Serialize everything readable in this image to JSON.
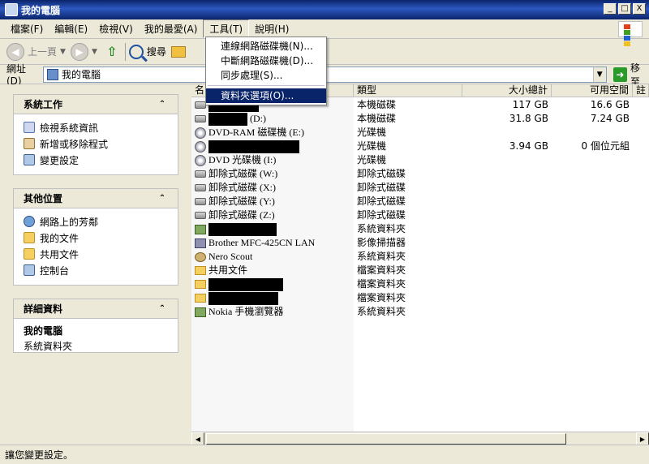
{
  "window": {
    "title": "我的電腦",
    "controls": {
      "minimize": "_",
      "maximize": "□",
      "close": "X"
    }
  },
  "menubar": {
    "items": [
      "檔案(F)",
      "編輯(E)",
      "檢視(V)",
      "我的最愛(A)",
      "工具(T)",
      "說明(H)"
    ],
    "active_index": 4
  },
  "toolbar": {
    "back_label": "上一頁",
    "search_label": "搜尋"
  },
  "address": {
    "label": "網址(D)",
    "value": "我的電腦",
    "go_label": "移至"
  },
  "tools_menu": {
    "items": [
      "連線網路磁碟機(N)...",
      "中斷網路磁碟機(D)...",
      "同步處理(S)...",
      "資料夾選項(O)..."
    ],
    "highlighted_index": 3
  },
  "left_pane": {
    "system_tasks": {
      "title": "系統工作",
      "items": [
        "檢視系統資訊",
        "新增或移除程式",
        "變更設定"
      ]
    },
    "other_places": {
      "title": "其他位置",
      "items": [
        "網路上的芳鄰",
        "我的文件",
        "共用文件",
        "控制台"
      ]
    },
    "details": {
      "title": "詳細資料",
      "name": "我的電腦",
      "type": "系統資料夾"
    }
  },
  "columns": {
    "name": "名",
    "type": "類型",
    "size": "大小總計",
    "free": "可用空間",
    "comment": "註"
  },
  "rows": [
    {
      "icon": "hard-drive-icon",
      "name": "",
      "redacted": true,
      "type": "本機磁碟",
      "size": "117 GB",
      "free": "16.6 GB"
    },
    {
      "icon": "hard-drive-icon",
      "name": "(D:)",
      "redacted": true,
      "type": "本機磁碟",
      "size": "31.8 GB",
      "free": "7.24 GB"
    },
    {
      "icon": "cd-drive-icon",
      "name": "DVD-RAM 磁碟機 (E:)",
      "redacted": false,
      "type": "光碟機",
      "size": "",
      "free": ""
    },
    {
      "icon": "cd-drive-icon",
      "name": "",
      "redacted": true,
      "type": "光碟機",
      "size": "3.94 GB",
      "free": "0 個位元組"
    },
    {
      "icon": "cd-drive-icon",
      "name": "DVD 光碟機 (I:)",
      "redacted": false,
      "type": "光碟機",
      "size": "",
      "free": ""
    },
    {
      "icon": "removable-drive-icon",
      "name": "卸除式磁碟 (W:)",
      "redacted": false,
      "type": "卸除式磁碟",
      "size": "",
      "free": ""
    },
    {
      "icon": "removable-drive-icon",
      "name": "卸除式磁碟 (X:)",
      "redacted": false,
      "type": "卸除式磁碟",
      "size": "",
      "free": ""
    },
    {
      "icon": "removable-drive-icon",
      "name": "卸除式磁碟 (Y:)",
      "redacted": false,
      "type": "卸除式磁碟",
      "size": "",
      "free": ""
    },
    {
      "icon": "removable-drive-icon",
      "name": "卸除式磁碟 (Z:)",
      "redacted": false,
      "type": "卸除式磁碟",
      "size": "",
      "free": ""
    },
    {
      "icon": "system-folder-icon",
      "name": "",
      "redacted": true,
      "type": "系統資料夾",
      "size": "",
      "free": ""
    },
    {
      "icon": "scanner-icon",
      "name": "Brother MFC-425CN LAN",
      "redacted": false,
      "type": "影像掃描器",
      "size": "",
      "free": ""
    },
    {
      "icon": "nero-scout-icon",
      "name": "Nero Scout",
      "redacted": false,
      "type": "系統資料夾",
      "size": "",
      "free": ""
    },
    {
      "icon": "folder-icon",
      "name": "共用文件",
      "redacted": false,
      "type": "檔案資料夾",
      "size": "",
      "free": ""
    },
    {
      "icon": "folder-icon",
      "name": "",
      "redacted": true,
      "type": "檔案資料夾",
      "size": "",
      "free": ""
    },
    {
      "icon": "folder-icon",
      "name": "",
      "redacted": true,
      "type": "檔案資料夾",
      "size": "",
      "free": ""
    },
    {
      "icon": "phone-browser-icon",
      "name": "Nokia 手機瀏覽器",
      "redacted": false,
      "type": "系統資料夾",
      "size": "",
      "free": ""
    }
  ],
  "status": "讓您變更設定。"
}
